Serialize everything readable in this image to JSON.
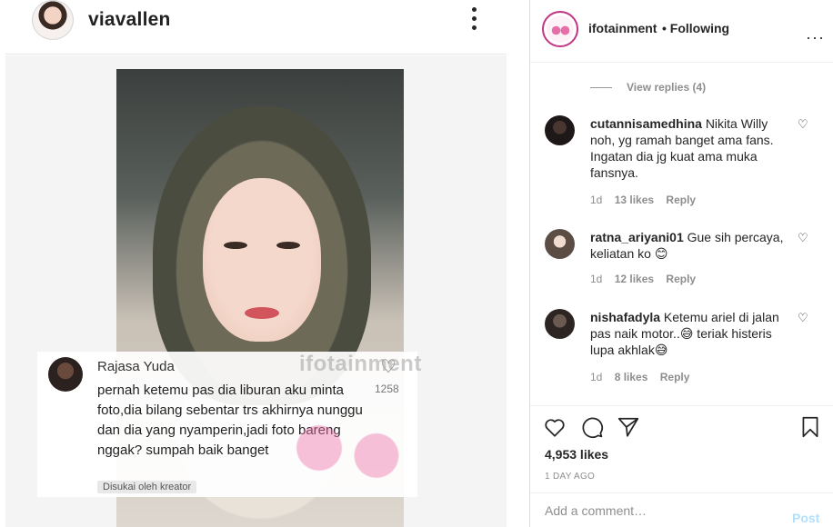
{
  "photo_post": {
    "header": {
      "username": "viavallen"
    },
    "embedded_comment": {
      "username": "Rajasa Yuda",
      "text": "pernah ketemu pas dia liburan aku minta foto,dia bilang sebentar trs akhirnya nunggu dan dia yang nyamperin,jadi foto bareng nggak? sumpah baik banget",
      "likes": "1258",
      "liked_by_creator": "Disukai oleh kreator"
    },
    "watermark": "ifotainment"
  },
  "header": {
    "username": "ifotainment",
    "follow_status": "• Following"
  },
  "comments": {
    "view_replies": "View replies (4)",
    "items": [
      {
        "username": "cutannisamedhina",
        "text": "Nikita Willy noh, yg ramah banget ama fans. Ingatan dia jg kuat ama muka fansnya.",
        "time": "1d",
        "likes": "13 likes",
        "reply": "Reply"
      },
      {
        "username": "ratna_ariyani01",
        "text": "Gue sih percaya, keliatan ko 😊",
        "time": "1d",
        "likes": "12 likes",
        "reply": "Reply"
      },
      {
        "username": "nishafadyla",
        "text": "Ketemu ariel di jalan pas naik motor..😅 teriak histeris lupa akhlak😅",
        "time": "1d",
        "likes": "8 likes",
        "reply": "Reply"
      }
    ]
  },
  "actions": {
    "likes": "4,953 likes",
    "date": "1 DAY AGO"
  },
  "add_comment": {
    "placeholder": "Add a comment…",
    "post_label": "Post"
  },
  "colors": {
    "link_blue_disabled": "#b2dffc",
    "secondary_text": "#8e8e8e",
    "primary_text": "#262626"
  }
}
